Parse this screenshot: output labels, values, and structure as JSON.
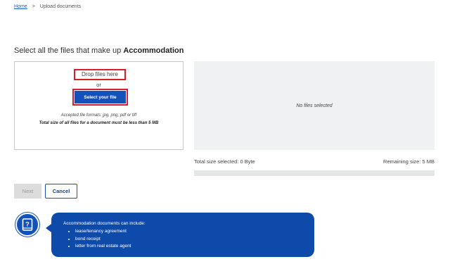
{
  "breadcrumb": {
    "home": "Home",
    "separator": ">",
    "current": "Upload documents"
  },
  "heading": {
    "prefix": "Select all the files that make up",
    "document": "Accommodation"
  },
  "dropzone": {
    "drop_label": "Drop files here",
    "or_label": "or",
    "select_button": "Select your file",
    "accepted_formats": "Accepted file formats: jpg, png, pdf or tiff",
    "size_limit": "Total size of all files for a document must be less than 5 MB"
  },
  "files_panel": {
    "empty_text": "No files selected"
  },
  "size": {
    "total_selected": "Total size selected: 0 Byte",
    "remaining": "Remaining size: 5 MB",
    "used_fraction": 0
  },
  "actions": {
    "next": "Next",
    "cancel": "Cancel"
  },
  "info": {
    "intro": "Accommodation documents can include:",
    "items": [
      "lease/tenancy agreement",
      "bond receipt",
      "letter from real estate agent"
    ]
  },
  "colors": {
    "primary": "#1552b8",
    "highlight": "#d4202c",
    "info_background": "#0e4aaa"
  }
}
